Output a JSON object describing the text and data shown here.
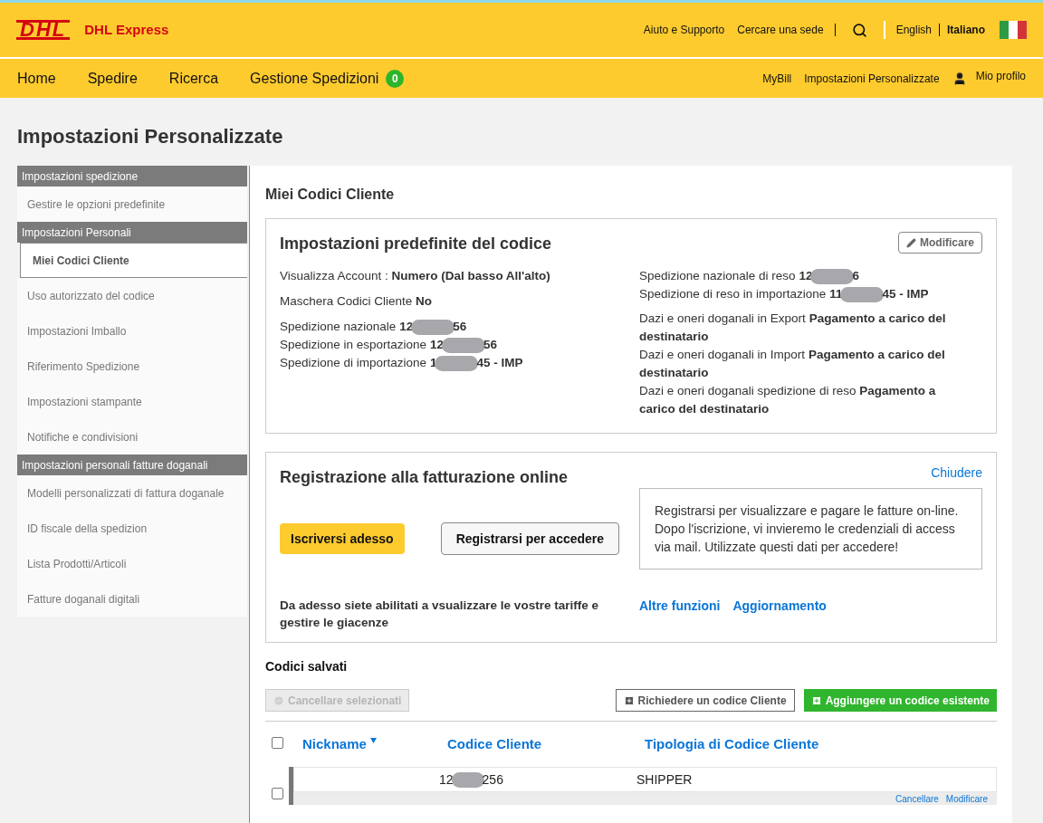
{
  "header": {
    "logo_mark": "DHL",
    "logo_text": "DHL Express",
    "top_links": [
      "Aiuto e Supporto",
      "Cercare una sede"
    ],
    "languages": [
      {
        "label": "English",
        "selected": false
      },
      {
        "label": "Italiano",
        "selected": true
      }
    ]
  },
  "nav": {
    "items": [
      {
        "label": "Home"
      },
      {
        "label": "Spedire"
      },
      {
        "label": "Ricerca"
      },
      {
        "label": "Gestione Spedizioni",
        "badge": "0"
      }
    ],
    "right_links": [
      "MyBill",
      "Impostazioni Personalizzate"
    ],
    "profile": "Mio profilo"
  },
  "page_title": "Impostazioni Personalizzate",
  "sidebar": {
    "sections": [
      {
        "heading": "Impostazioni spedizione",
        "items": [
          {
            "label": "Gestire le opzioni predefinite",
            "selected": false
          }
        ]
      },
      {
        "heading": "Impostazioni Personali",
        "items": [
          {
            "label": "Miei Codici Cliente",
            "selected": true
          },
          {
            "label": "Uso autorizzato del codice",
            "selected": false
          },
          {
            "label": "Impostazioni Imballo",
            "selected": false
          },
          {
            "label": "Riferimento Spedizione",
            "selected": false
          },
          {
            "label": "Impostazioni stampante",
            "selected": false
          },
          {
            "label": "Notifiche e condivisioni",
            "selected": false
          }
        ]
      },
      {
        "heading": "Impostazioni personali fatture doganali",
        "items": [
          {
            "label": "Modelli personalizzati di fattura doganale",
            "selected": false
          },
          {
            "label": "ID fiscale della spedizion",
            "selected": false
          },
          {
            "label": "Lista Prodotti/Articoli",
            "selected": false
          },
          {
            "label": "Fatture doganali digitali",
            "selected": false
          }
        ]
      }
    ]
  },
  "main_title": "Miei Codici Cliente",
  "defaults_panel": {
    "title": "Impostazioni predefinite del codice",
    "edit_button": "Modificare",
    "left_groups": [
      [
        {
          "kind": "plain",
          "label": "Visualizza Account :",
          "value": "Numero (Dal basso All'alto)"
        }
      ],
      [
        {
          "kind": "plain",
          "label": "Maschera Codici Cliente",
          "value": "No"
        }
      ],
      [
        {
          "kind": "code",
          "label": "Spedizione nazionale",
          "value_start": "12",
          "value_end": "56"
        },
        {
          "kind": "code",
          "label": "Spedizione in esportazione",
          "value_start": "12",
          "value_end": "56"
        },
        {
          "kind": "code",
          "label": "Spedizione di importazione",
          "value_start": "1",
          "value_end": "45 - IMP"
        }
      ]
    ],
    "right_groups": [
      [
        {
          "kind": "code",
          "label": "Spedizione nazionale di reso",
          "value_start": "12",
          "value_end": "6"
        },
        {
          "kind": "code",
          "label": "Spedizione di reso in importazione",
          "value_start": "11",
          "value_end": "45 - IMP"
        }
      ],
      [
        {
          "kind": "plain",
          "label": "Dazi e oneri doganali in Export",
          "value": "Pagamento a carico del destinatario"
        },
        {
          "kind": "plain",
          "label": "Dazi e oneri doganali in Import",
          "value": "Pagamento a carico del destinatario"
        },
        {
          "kind": "plain",
          "label": "Dazi e oneri doganali spedizione di reso",
          "value": "Pagamento a carico del destinatario"
        }
      ]
    ]
  },
  "billing_panel": {
    "title": "Registrazione alla fatturazione online",
    "close_link": "Chiudere",
    "buttons": [
      {
        "label": "Iscriversi adesso",
        "kind": "primary"
      },
      {
        "label": "Registrarsi per accedere",
        "kind": "secondary"
      }
    ],
    "info": "Registrarsi per visualizzare e pagare le fatture on-line. Dopo l'iscrizione, vi invieremo le credenziali di access via mail. Utilizzate questi dati per accedere!",
    "note": "Da adesso siete abilitati a vsualizzare le vostre tariffe e gestire le giacenze",
    "links": [
      "Altre funzioni",
      "Aggiornamento"
    ]
  },
  "saved_codes": {
    "title": "Codici salvati",
    "buttons": [
      {
        "label": "Cancellare selezionati",
        "kind": "disabled"
      },
      {
        "label": "Richiedere un codice Cliente",
        "kind": "outline"
      },
      {
        "label": "Aggiungere un codice esistente",
        "kind": "success"
      }
    ],
    "select_all": {
      "checked": false
    },
    "columns": [
      {
        "label": "Nickname",
        "sorted": true
      },
      {
        "label": "Codice Cliente",
        "sorted": false
      },
      {
        "label": "Tipologia di Codice Cliente",
        "sorted": false
      }
    ],
    "rows": [
      {
        "checked": false,
        "code_start": "12",
        "code_end": "256",
        "type": "SHIPPER",
        "actions": [
          "Cancellare",
          "Modificare"
        ]
      }
    ]
  }
}
